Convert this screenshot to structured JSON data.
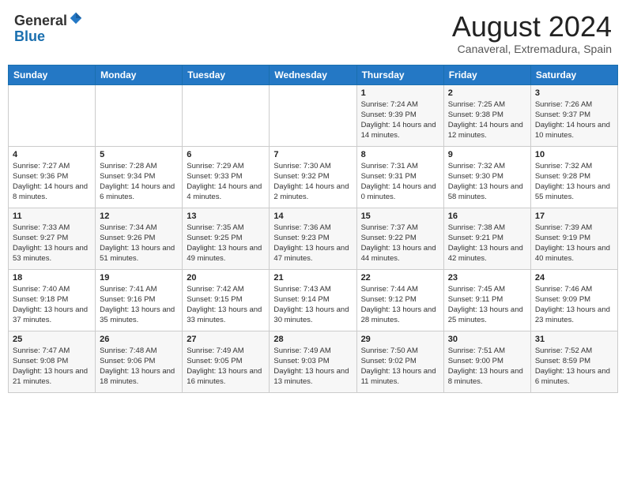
{
  "header": {
    "logo_line1": "General",
    "logo_line2": "Blue",
    "month_year": "August 2024",
    "location": "Canaveral, Extremadura, Spain"
  },
  "weekdays": [
    "Sunday",
    "Monday",
    "Tuesday",
    "Wednesday",
    "Thursday",
    "Friday",
    "Saturday"
  ],
  "weeks": [
    [
      {
        "day": "",
        "info": ""
      },
      {
        "day": "",
        "info": ""
      },
      {
        "day": "",
        "info": ""
      },
      {
        "day": "",
        "info": ""
      },
      {
        "day": "1",
        "info": "Sunrise: 7:24 AM\nSunset: 9:39 PM\nDaylight: 14 hours and 14 minutes."
      },
      {
        "day": "2",
        "info": "Sunrise: 7:25 AM\nSunset: 9:38 PM\nDaylight: 14 hours and 12 minutes."
      },
      {
        "day": "3",
        "info": "Sunrise: 7:26 AM\nSunset: 9:37 PM\nDaylight: 14 hours and 10 minutes."
      }
    ],
    [
      {
        "day": "4",
        "info": "Sunrise: 7:27 AM\nSunset: 9:36 PM\nDaylight: 14 hours and 8 minutes."
      },
      {
        "day": "5",
        "info": "Sunrise: 7:28 AM\nSunset: 9:34 PM\nDaylight: 14 hours and 6 minutes."
      },
      {
        "day": "6",
        "info": "Sunrise: 7:29 AM\nSunset: 9:33 PM\nDaylight: 14 hours and 4 minutes."
      },
      {
        "day": "7",
        "info": "Sunrise: 7:30 AM\nSunset: 9:32 PM\nDaylight: 14 hours and 2 minutes."
      },
      {
        "day": "8",
        "info": "Sunrise: 7:31 AM\nSunset: 9:31 PM\nDaylight: 14 hours and 0 minutes."
      },
      {
        "day": "9",
        "info": "Sunrise: 7:32 AM\nSunset: 9:30 PM\nDaylight: 13 hours and 58 minutes."
      },
      {
        "day": "10",
        "info": "Sunrise: 7:32 AM\nSunset: 9:28 PM\nDaylight: 13 hours and 55 minutes."
      }
    ],
    [
      {
        "day": "11",
        "info": "Sunrise: 7:33 AM\nSunset: 9:27 PM\nDaylight: 13 hours and 53 minutes."
      },
      {
        "day": "12",
        "info": "Sunrise: 7:34 AM\nSunset: 9:26 PM\nDaylight: 13 hours and 51 minutes."
      },
      {
        "day": "13",
        "info": "Sunrise: 7:35 AM\nSunset: 9:25 PM\nDaylight: 13 hours and 49 minutes."
      },
      {
        "day": "14",
        "info": "Sunrise: 7:36 AM\nSunset: 9:23 PM\nDaylight: 13 hours and 47 minutes."
      },
      {
        "day": "15",
        "info": "Sunrise: 7:37 AM\nSunset: 9:22 PM\nDaylight: 13 hours and 44 minutes."
      },
      {
        "day": "16",
        "info": "Sunrise: 7:38 AM\nSunset: 9:21 PM\nDaylight: 13 hours and 42 minutes."
      },
      {
        "day": "17",
        "info": "Sunrise: 7:39 AM\nSunset: 9:19 PM\nDaylight: 13 hours and 40 minutes."
      }
    ],
    [
      {
        "day": "18",
        "info": "Sunrise: 7:40 AM\nSunset: 9:18 PM\nDaylight: 13 hours and 37 minutes."
      },
      {
        "day": "19",
        "info": "Sunrise: 7:41 AM\nSunset: 9:16 PM\nDaylight: 13 hours and 35 minutes."
      },
      {
        "day": "20",
        "info": "Sunrise: 7:42 AM\nSunset: 9:15 PM\nDaylight: 13 hours and 33 minutes."
      },
      {
        "day": "21",
        "info": "Sunrise: 7:43 AM\nSunset: 9:14 PM\nDaylight: 13 hours and 30 minutes."
      },
      {
        "day": "22",
        "info": "Sunrise: 7:44 AM\nSunset: 9:12 PM\nDaylight: 13 hours and 28 minutes."
      },
      {
        "day": "23",
        "info": "Sunrise: 7:45 AM\nSunset: 9:11 PM\nDaylight: 13 hours and 25 minutes."
      },
      {
        "day": "24",
        "info": "Sunrise: 7:46 AM\nSunset: 9:09 PM\nDaylight: 13 hours and 23 minutes."
      }
    ],
    [
      {
        "day": "25",
        "info": "Sunrise: 7:47 AM\nSunset: 9:08 PM\nDaylight: 13 hours and 21 minutes."
      },
      {
        "day": "26",
        "info": "Sunrise: 7:48 AM\nSunset: 9:06 PM\nDaylight: 13 hours and 18 minutes."
      },
      {
        "day": "27",
        "info": "Sunrise: 7:49 AM\nSunset: 9:05 PM\nDaylight: 13 hours and 16 minutes."
      },
      {
        "day": "28",
        "info": "Sunrise: 7:49 AM\nSunset: 9:03 PM\nDaylight: 13 hours and 13 minutes."
      },
      {
        "day": "29",
        "info": "Sunrise: 7:50 AM\nSunset: 9:02 PM\nDaylight: 13 hours and 11 minutes."
      },
      {
        "day": "30",
        "info": "Sunrise: 7:51 AM\nSunset: 9:00 PM\nDaylight: 13 hours and 8 minutes."
      },
      {
        "day": "31",
        "info": "Sunrise: 7:52 AM\nSunset: 8:59 PM\nDaylight: 13 hours and 6 minutes."
      }
    ]
  ]
}
